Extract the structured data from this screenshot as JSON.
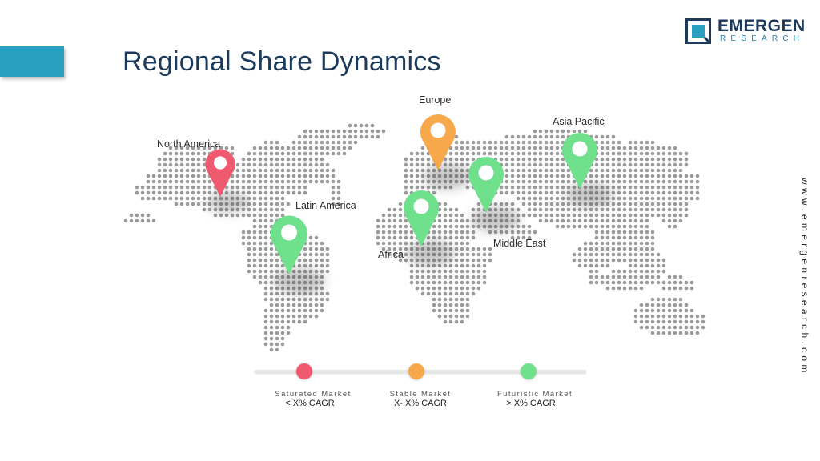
{
  "title": "Regional Share Dynamics",
  "brand": {
    "name": "EMERGEN",
    "subtitle": "RESEARCH",
    "website": "www.emergenresearch.com",
    "colors": {
      "navy": "#1c3a5b",
      "accent": "#2a9fc0"
    }
  },
  "map": {
    "regions": [
      {
        "name": "North America",
        "status": "Saturated Market"
      },
      {
        "name": "Europe",
        "status": "Stable Market"
      },
      {
        "name": "Asia Pacific",
        "status": "Futuristic Market"
      },
      {
        "name": "Latin America",
        "status": "Futuristic Market"
      },
      {
        "name": "Africa",
        "status": "Futuristic Market"
      },
      {
        "name": "Middle East",
        "status": "Futuristic Market"
      }
    ]
  },
  "legend": [
    {
      "label": "Saturated Market",
      "sub": "< X% CAGR",
      "color": "#f05a6e"
    },
    {
      "label": "Stable Market",
      "sub": "X- X% CAGR",
      "color": "#f7a84a"
    },
    {
      "label": "Futuristic Market",
      "sub": "> X% CAGR",
      "color": "#6fe08c"
    }
  ]
}
